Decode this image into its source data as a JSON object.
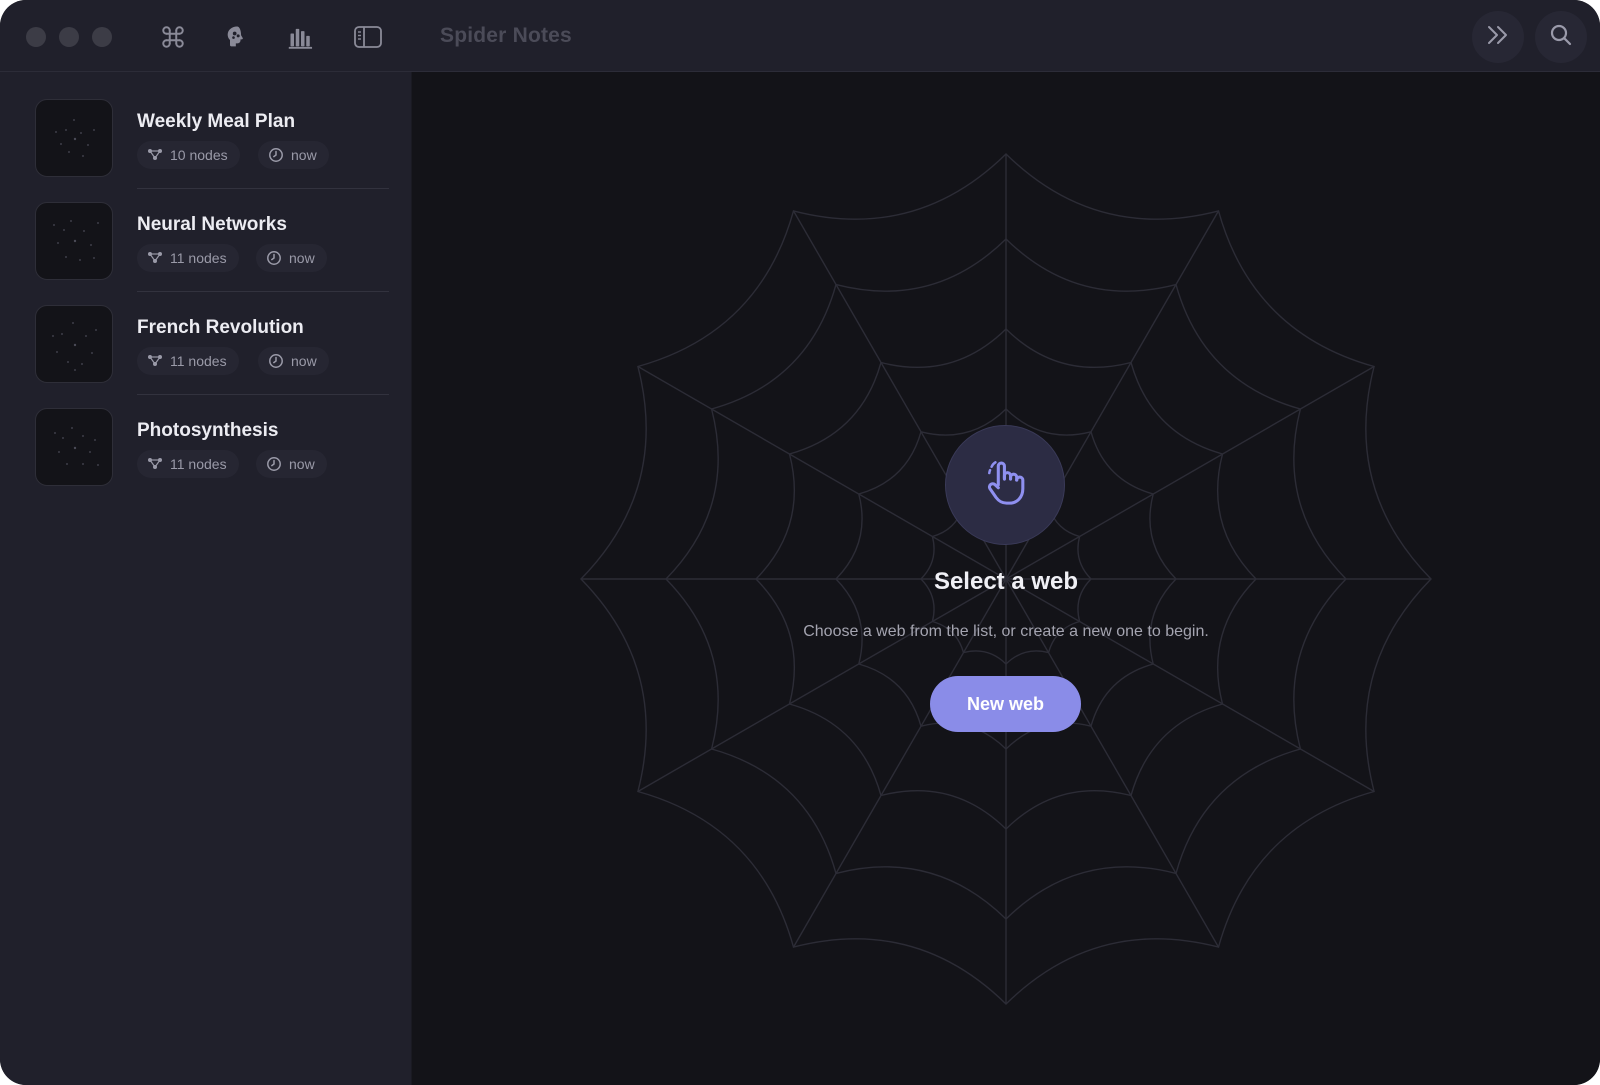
{
  "window": {
    "title": "Spider Notes",
    "traffic_lights": [
      "close",
      "minimize",
      "zoom"
    ]
  },
  "toolbar": {
    "icons": [
      "command-icon",
      "brain-icon",
      "bar-chart-icon",
      "sidebar-toggle-icon"
    ],
    "right_buttons": [
      "expand-chevrons-icon",
      "search-icon"
    ]
  },
  "sidebar": {
    "items": [
      {
        "title": "Weekly Meal Plan",
        "nodes": "10 nodes",
        "time": "now"
      },
      {
        "title": "Neural Networks",
        "nodes": "11 nodes",
        "time": "now"
      },
      {
        "title": "French Revolution",
        "nodes": "11 nodes",
        "time": "now"
      },
      {
        "title": "Photosynthesis",
        "nodes": "11 nodes",
        "time": "now"
      }
    ]
  },
  "main": {
    "empty_title": "Select a web",
    "empty_subtitle": "Choose a web from the list, or create a new one to begin.",
    "new_button": "New web"
  },
  "colors": {
    "accent": "#8a8ce8",
    "background": "#131318",
    "sidebar": "#20202b"
  }
}
